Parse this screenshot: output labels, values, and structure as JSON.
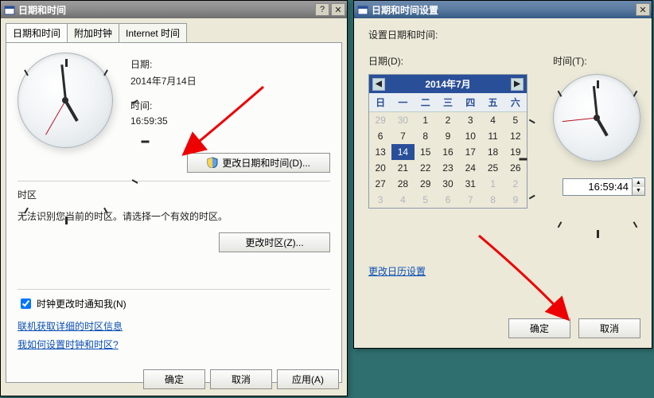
{
  "win1": {
    "title": "日期和时间",
    "tabs": [
      "日期和时间",
      "附加时钟",
      "Internet 时间"
    ],
    "date_label": "日期:",
    "date_value": "2014年7月14日",
    "time_label": "时间:",
    "time_value": "16:59:35",
    "change_dt_btn": "更改日期和时间(D)...",
    "tz_heading": "时区",
    "tz_msg": "无法识别您当前的时区。请选择一个有效的时区。",
    "change_tz_btn": "更改时区(Z)...",
    "notify_label": "时钟更改时通知我(N)",
    "link_tzinfo": "联机获取详细的时区信息",
    "link_howto": "我如何设置时钟和时区?",
    "ok": "确定",
    "cancel": "取消",
    "apply": "应用(A)"
  },
  "win2": {
    "title": "日期和时间设置",
    "set_label": "设置日期和时间:",
    "date_field": "日期(D):",
    "time_field": "时间(T):",
    "cal_month": "2014年7月",
    "dow": [
      "日",
      "一",
      "二",
      "三",
      "四",
      "五",
      "六"
    ],
    "link_calset": "更改日历设置",
    "ok": "确定",
    "cancel": "取消",
    "time_value": "16:59:44"
  }
}
